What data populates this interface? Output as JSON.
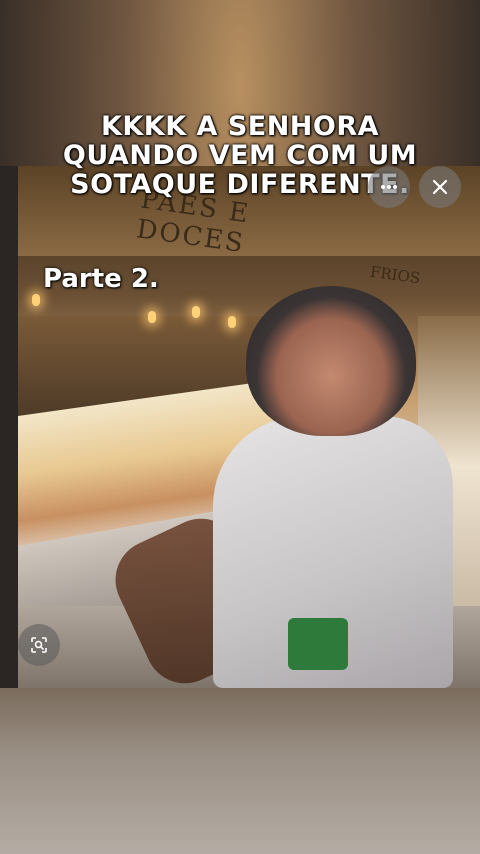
{
  "caption": {
    "line1": "KKKK A SENHORA",
    "line2": "QUANDO VEM COM UM",
    "line3": "SOTAQUE DIFERENTE."
  },
  "part_label": "Parte 2.",
  "scene": {
    "sign_text": "PÃES E DOCES",
    "frios_text": "FRIOS"
  },
  "controls": {
    "more_icon": "more-horizontal-icon",
    "close_icon": "close-icon",
    "lens_icon": "visual-search-icon"
  }
}
